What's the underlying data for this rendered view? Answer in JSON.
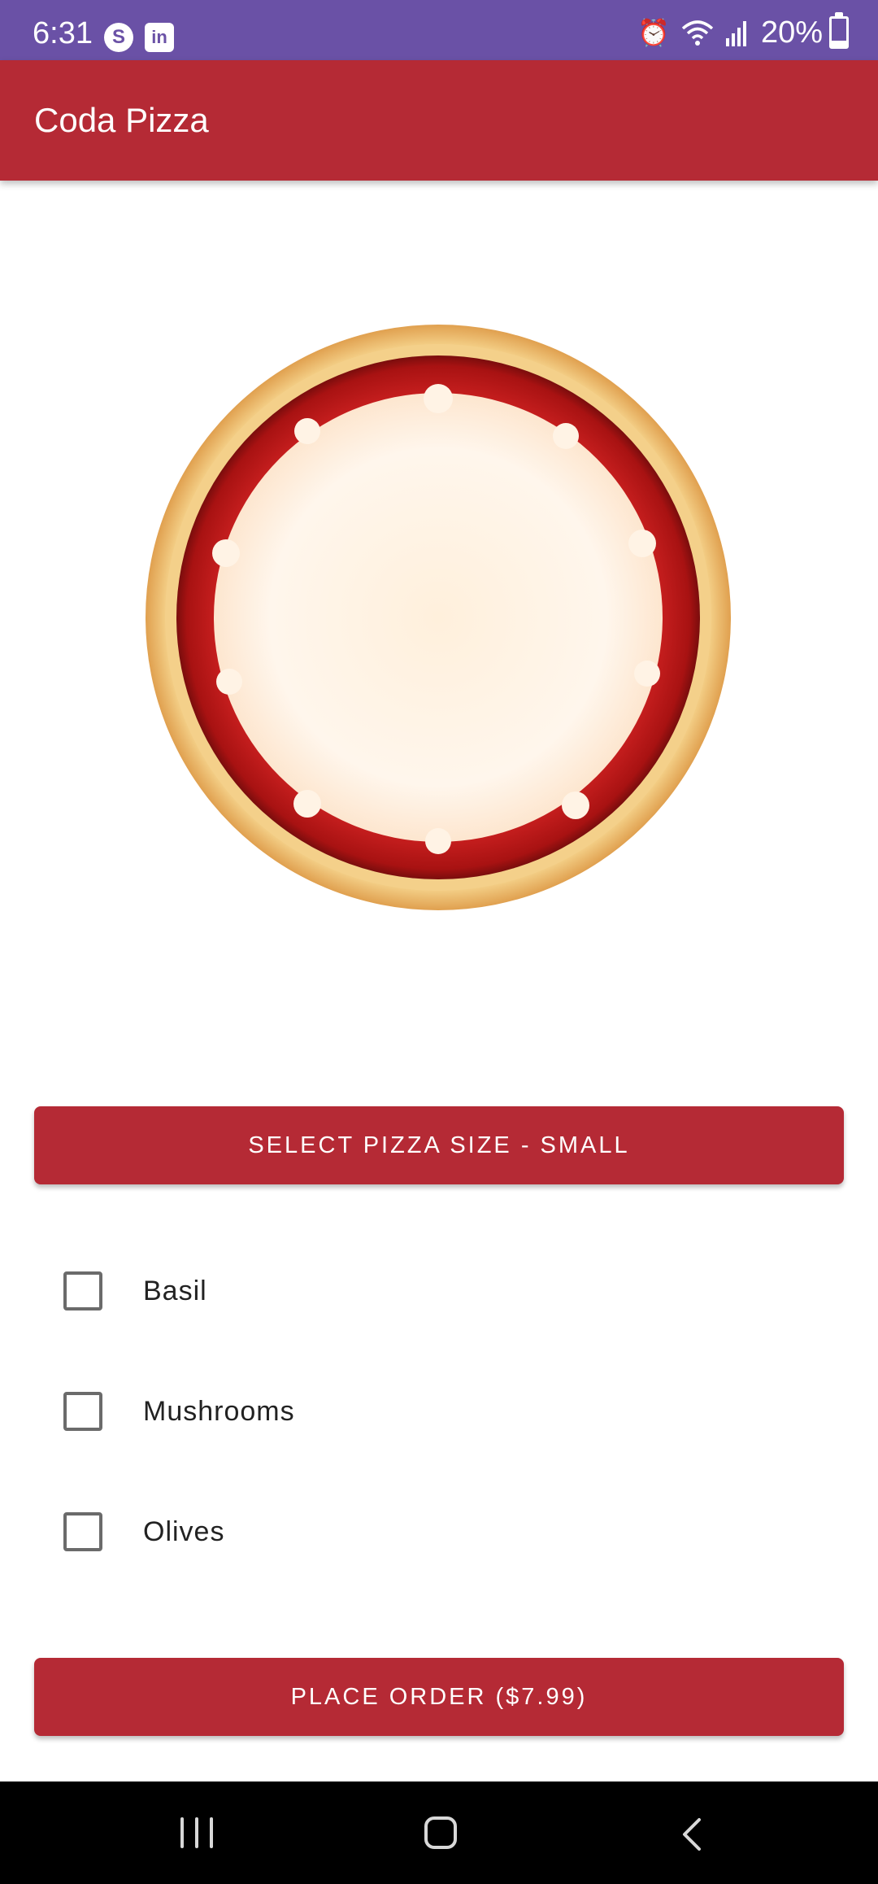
{
  "status_bar": {
    "time": "6:31",
    "app_icons": [
      "S",
      "in"
    ],
    "battery_percent_text": "20%",
    "battery_level": 0.2,
    "icons": [
      "alarm-icon",
      "wifi-icon",
      "signal-icon",
      "battery-icon"
    ]
  },
  "app_bar": {
    "title": "Coda Pizza"
  },
  "pizza": {
    "icon": "pizza-crust-image"
  },
  "size_button": {
    "label": "SELECT PIZZA SIZE - SMALL"
  },
  "toppings": [
    {
      "label": "Basil",
      "checked": false
    },
    {
      "label": "Mushrooms",
      "checked": false
    },
    {
      "label": "Olives",
      "checked": false
    }
  ],
  "order_button": {
    "label": "PLACE ORDER ($7.99)"
  },
  "colors": {
    "status_bar": "#6a51a6",
    "primary": "#b52a35",
    "sauce": "#c81e1e",
    "crust": "#f2c877",
    "cheese": "#fff3e0"
  },
  "nav_bar": {
    "icons": [
      "recents-icon",
      "home-icon",
      "back-icon"
    ]
  }
}
